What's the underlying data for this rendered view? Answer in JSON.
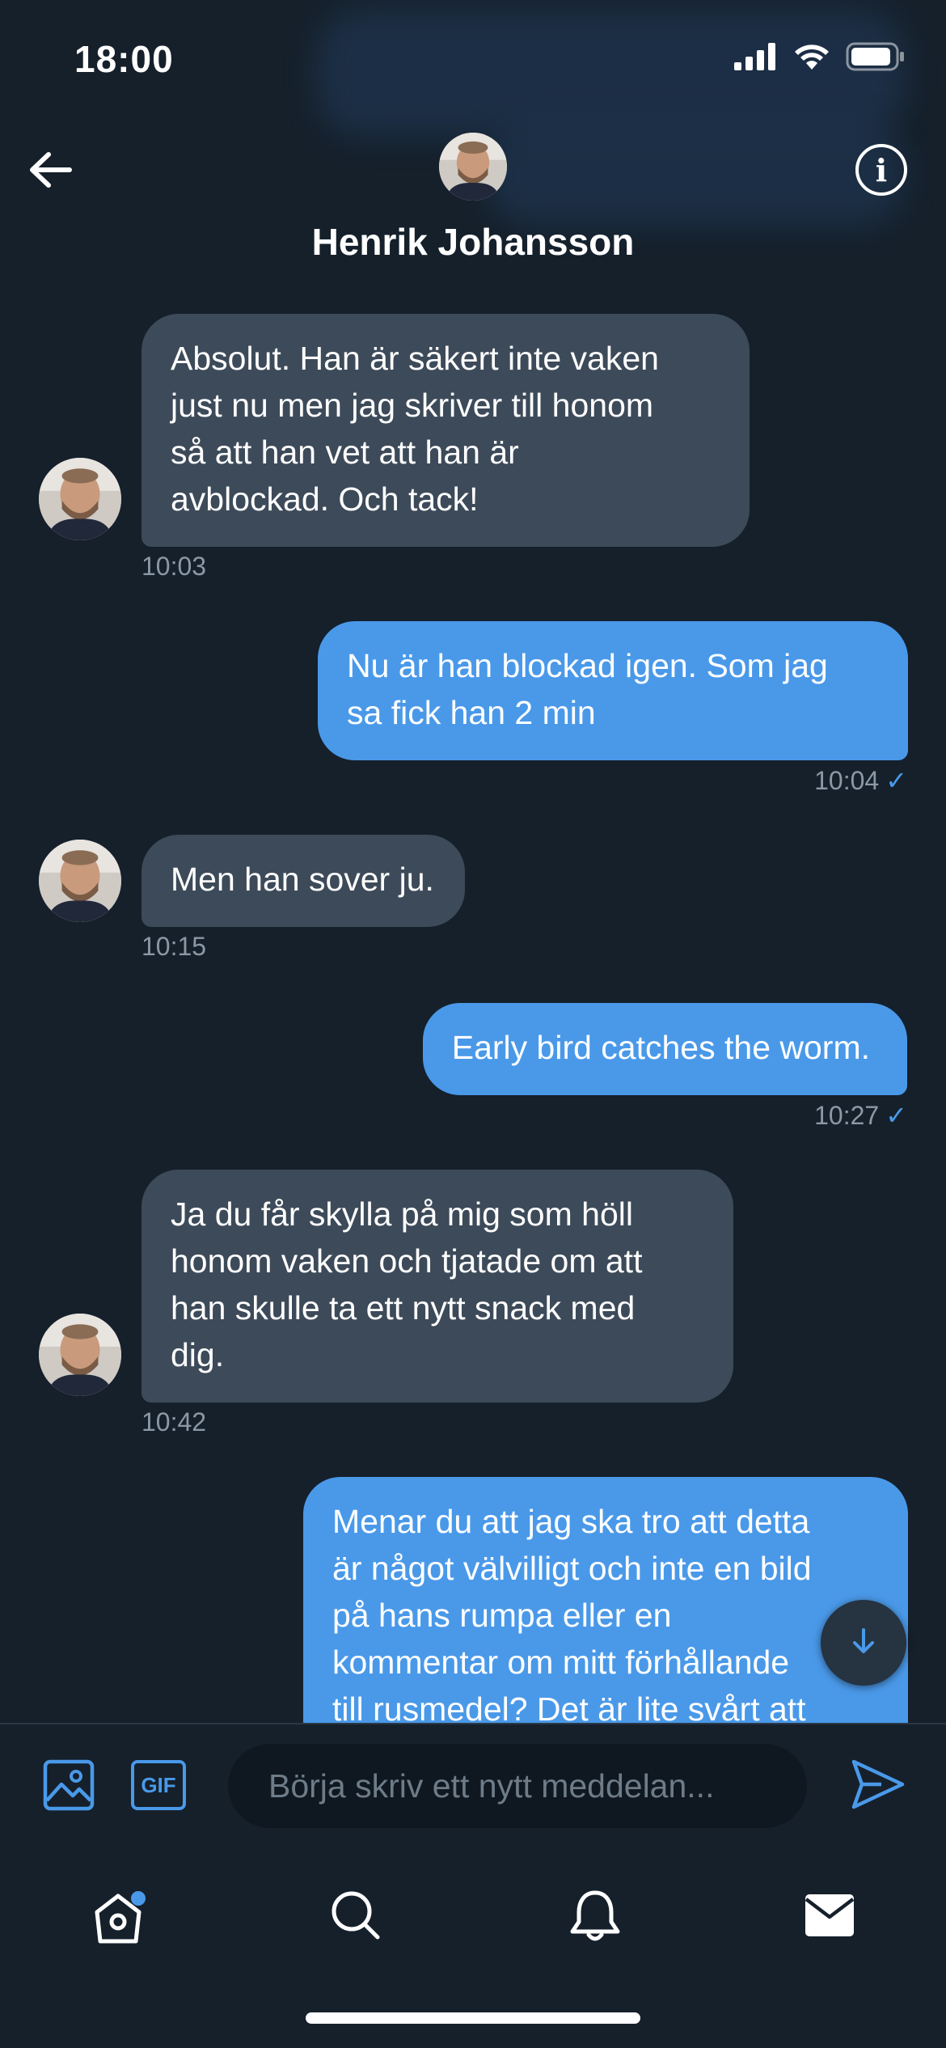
{
  "status_bar": {
    "time": "18:00",
    "icons": [
      "cellular-signal-icon",
      "wifi-icon",
      "battery-icon"
    ]
  },
  "header": {
    "back_icon": "arrow-left-icon",
    "contact_name": "Henrik Johansson",
    "info_icon": "info-icon",
    "info_glyph": "i"
  },
  "messages": [
    {
      "direction": "in",
      "lines": [
        "Absolut. Han är säkert inte vaken",
        "just nu men jag skriver till honom",
        "så att han vet att han är",
        "avblockad. Och tack!"
      ],
      "time": "10:03"
    },
    {
      "direction": "out",
      "lines": [
        "Nu är han blockad igen. Som jag",
        "sa fick han 2 min"
      ],
      "time": "10:04",
      "read_mark": "✓"
    },
    {
      "direction": "in",
      "lines": [
        "Men han sover ju."
      ],
      "time": "10:15"
    },
    {
      "direction": "out",
      "lines": [
        "Early bird catches the worm."
      ],
      "time": "10:27",
      "read_mark": "✓"
    },
    {
      "direction": "in",
      "lines": [
        "Ja du får skylla på mig som höll",
        "honom vaken och tjatade om att",
        "han skulle ta ett nytt snack med",
        "dig."
      ],
      "time": "10:42"
    },
    {
      "direction": "out",
      "lines": [
        "Menar du att jag ska tro att detta",
        "är något välvilligt och inte en bild",
        "på hans rumpa eller en",
        "kommentar om mitt förhållande",
        "till rusmedel? Det är lite svårt att"
      ]
    }
  ],
  "compose": {
    "media_icon": "image-icon",
    "gif_label": "GIF",
    "placeholder": "Börja skriv ett nytt meddelan...",
    "send_icon": "send-icon"
  },
  "scroll_button_icon": "arrow-down-icon",
  "tabbar": {
    "items": [
      "home-icon",
      "search-icon",
      "notifications-bell-icon",
      "messages-envelope-icon"
    ],
    "active": "messages-envelope-icon"
  },
  "colors": {
    "background": "#15202b",
    "incoming_bubble": "#3d4a59",
    "outgoing_bubble": "#4a99e9",
    "accent": "#4a99e9",
    "timestamp": "#8b98a5"
  }
}
